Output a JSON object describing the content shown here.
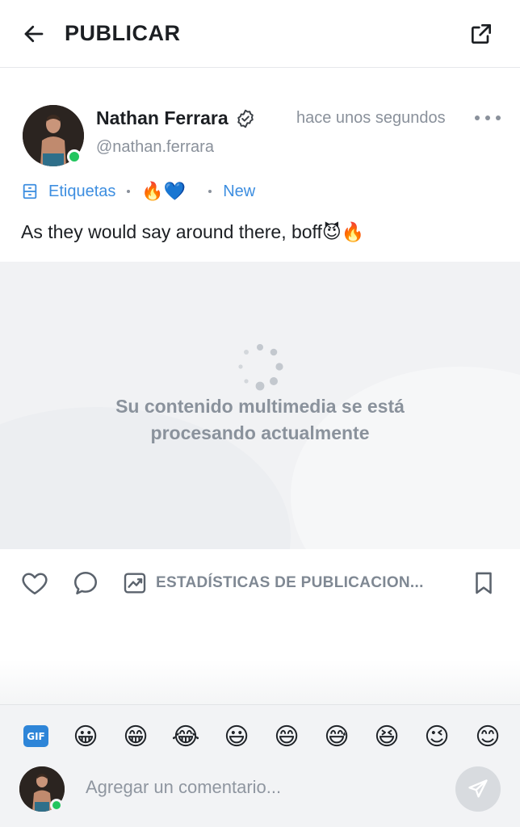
{
  "header": {
    "title": "PUBLICAR",
    "back_icon": "arrow-left-icon",
    "share_icon": "share-icon"
  },
  "post": {
    "author_name": "Nathan Ferrara",
    "author_handle": "@nathan.ferrara",
    "timestamp": "hace unos segundos",
    "tags_label": "Etiquetas",
    "tag_emojis": "🔥💙",
    "new_label": "New",
    "text": "As they would say around there, boff😈🔥",
    "media_status": "Su contenido multimedia se está procesando actualmente",
    "online_color": "#22c55e"
  },
  "actions": {
    "stats_label": "ESTADÍSTICAS DE PUBLICACION..."
  },
  "composer": {
    "gif_label": "GIF",
    "quick_emojis": [
      "😀",
      "😁",
      "😂",
      "😃",
      "😄",
      "😅",
      "😆",
      "😉",
      "😊"
    ],
    "comment_placeholder": "Agregar un comentario..."
  },
  "colors": {
    "accent": "#3d8ee0",
    "muted": "#8a919b",
    "online": "#22c55e"
  }
}
